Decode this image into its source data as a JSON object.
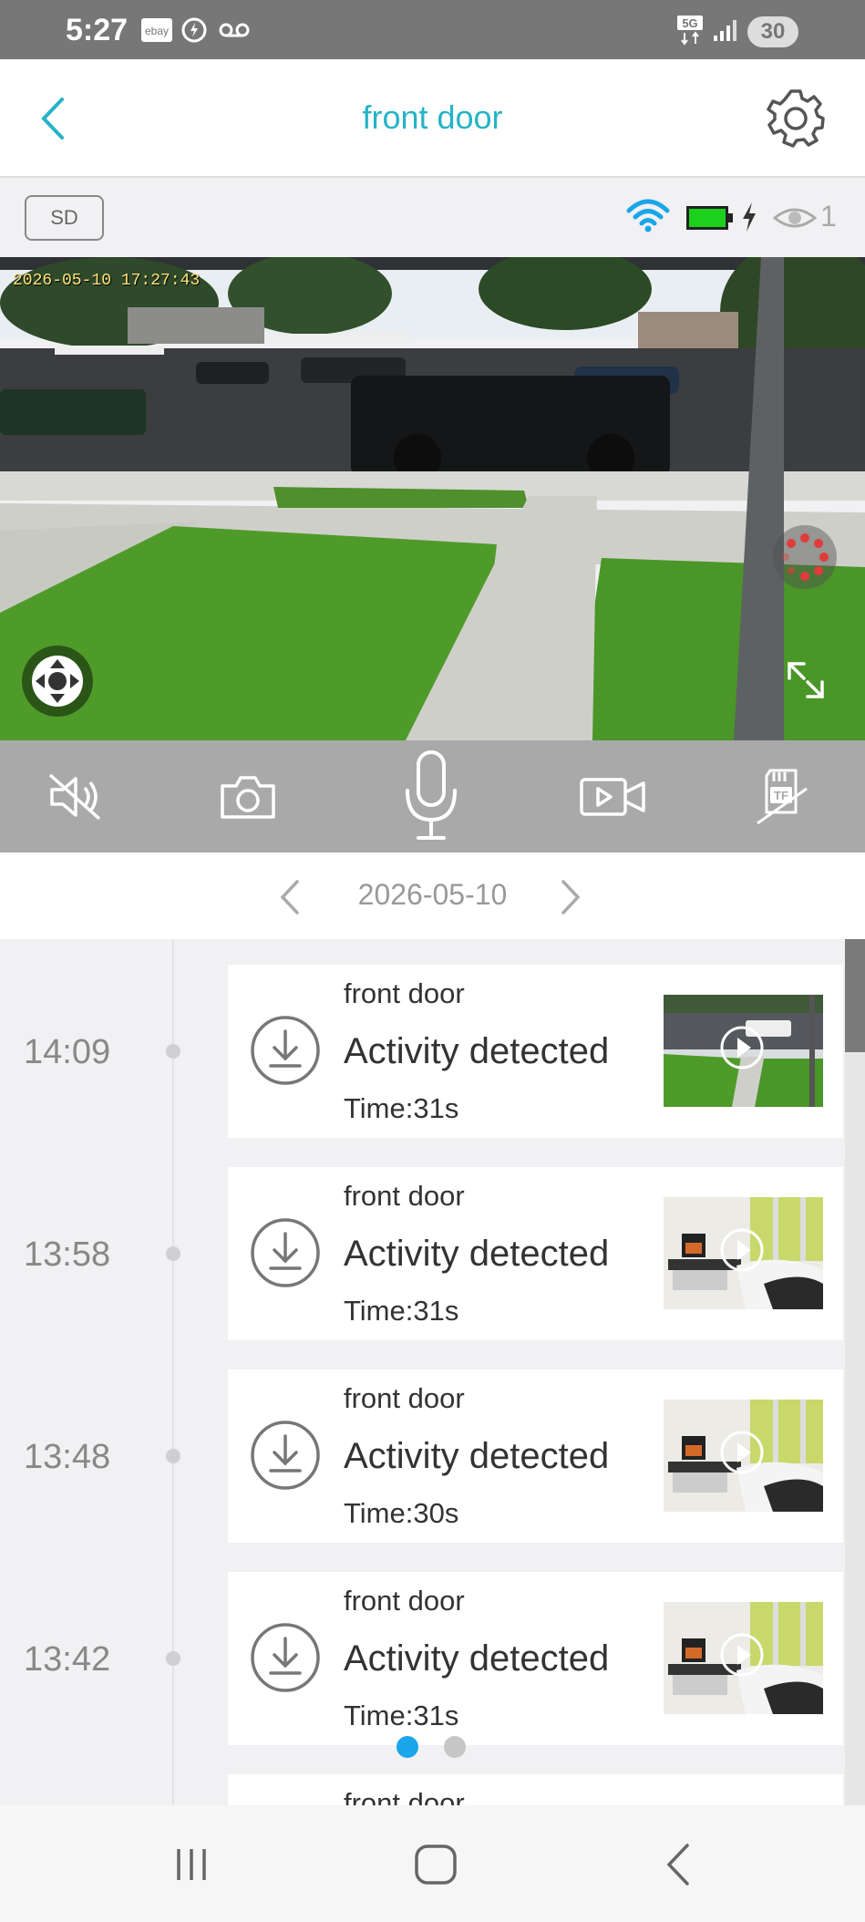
{
  "status_bar": {
    "time": "5:27",
    "notif_icons": [
      "ebay-icon",
      "wireless-charge-icon",
      "voicemail-icon"
    ],
    "network": "5G",
    "battery": "30"
  },
  "header": {
    "title": "front door",
    "back_icon": "chevron-left-icon",
    "settings_icon": "gear-icon"
  },
  "info_bar": {
    "quality": "SD",
    "viewers": "1",
    "battery_color": "#1bd11b",
    "wifi_color": "#1aa6e8"
  },
  "video": {
    "timestamp": "2026-05-10 17:27:43"
  },
  "controls": [
    "mute-icon",
    "snapshot-icon",
    "microphone-icon",
    "record-video-icon",
    "tf-card-icon"
  ],
  "date_nav": {
    "date": "2026-05-10"
  },
  "events": [
    {
      "time": "14:09",
      "camera": "front door",
      "title": "Activity detected",
      "duration": "Time:31s",
      "thumb": "outdoor"
    },
    {
      "time": "13:58",
      "camera": "front door",
      "title": "Activity detected",
      "duration": "Time:31s",
      "thumb": "room"
    },
    {
      "time": "13:48",
      "camera": "front door",
      "title": "Activity detected",
      "duration": "Time:30s",
      "thumb": "room"
    },
    {
      "time": "13:42",
      "camera": "front door",
      "title": "Activity detected",
      "duration": "Time:31s",
      "thumb": "room"
    },
    {
      "time": "",
      "camera": "front door",
      "title": "",
      "duration": "",
      "thumb": "none"
    }
  ],
  "pager": {
    "count": 2,
    "active": 0,
    "active_color": "#1aa6e8",
    "inactive_color": "#c6c6c6"
  },
  "accent_color": "#26b3c6"
}
